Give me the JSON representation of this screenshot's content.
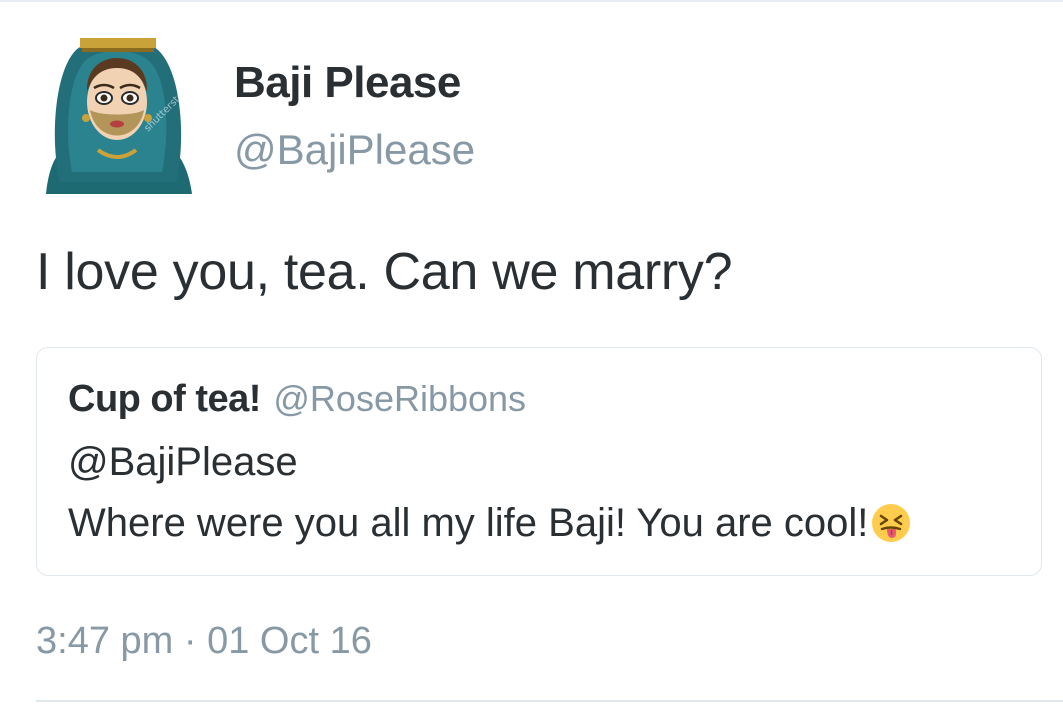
{
  "tweet": {
    "display_name": "Baji Please",
    "handle": "@BajiPlease",
    "avatar_icon": "avatar-hijab-woman-icon",
    "avatar_watermark": "shutterstock",
    "text": "I love you, tea. Can we marry?",
    "timestamp": "3:47 pm · 01 Oct 16"
  },
  "quoted_tweet": {
    "display_name": "Cup of tea!",
    "handle": "@RoseRibbons",
    "mention": "@BajiPlease",
    "text": "Where were you all my life Baji! You are cool!",
    "emoji_icon": "confounded-tongue-face-emoji-icon"
  },
  "colors": {
    "text_primary": "#292f33",
    "text_secondary": "#8899a6",
    "border": "#e1e8ed",
    "avatar_scarf": "#1f6f78"
  }
}
